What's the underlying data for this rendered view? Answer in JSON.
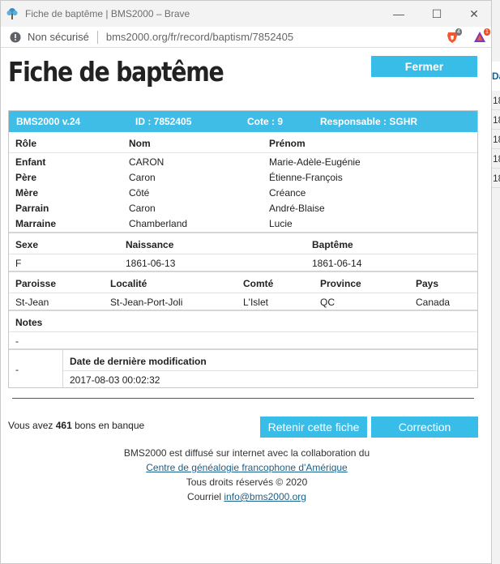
{
  "window": {
    "title": "Fiche de baptême | BMS2000 – Brave",
    "controls": {
      "minimize": "—",
      "maximize": "☐",
      "close": "✕"
    }
  },
  "address_bar": {
    "security_label": "Non sécurisé",
    "url": "bms2000.org/fr/record/baptism/7852405",
    "shield_count": "4",
    "rewards_count": "1"
  },
  "page": {
    "title": "Fiche de baptême",
    "close_label": "Fermer"
  },
  "record": {
    "banner": {
      "version": "BMS2000 v.24",
      "id": "ID : 7852405",
      "cote": "Cote : 9",
      "responsable": "Responsable : SGHR"
    },
    "people_headers": {
      "role": "Rôle",
      "nom": "Nom",
      "prenom": "Prénom"
    },
    "people": [
      {
        "role": "Enfant",
        "nom": "CARON",
        "prenom": "Marie-Adèle-Eugénie"
      },
      {
        "role": "Père",
        "nom": "Caron",
        "prenom": "Étienne-François"
      },
      {
        "role": "Mère",
        "nom": "Côté",
        "prenom": "Créance"
      },
      {
        "role": "Parrain",
        "nom": "Caron",
        "prenom": "André-Blaise"
      },
      {
        "role": "Marraine",
        "nom": "Chamberland",
        "prenom": "Lucie"
      }
    ],
    "vitals_headers": {
      "sexe": "Sexe",
      "naissance": "Naissance",
      "bapteme": "Baptême"
    },
    "vitals": {
      "sexe": "F",
      "naissance": "1861-06-13",
      "bapteme": "1861-06-14"
    },
    "place_headers": {
      "paroisse": "Paroisse",
      "localite": "Localité",
      "comte": "Comté",
      "province": "Province",
      "pays": "Pays"
    },
    "place": {
      "paroisse": "St-Jean",
      "localite": "St-Jean-Port-Joli",
      "comte": "L'Islet",
      "province": "QC",
      "pays": "Canada"
    },
    "notes_header": "Notes",
    "notes": "-",
    "modif_left": "-",
    "modif_header": "Date de dernière modification",
    "modif_value": "2017-08-03 00:02:32"
  },
  "footer": {
    "bank_prefix": "Vous avez",
    "bank_count": "461",
    "bank_suffix": "bons en banque",
    "retain_label": "Retenir cette fiche",
    "correction_label": "Correction",
    "credit_line": "BMS2000 est diffusé sur internet avec la collaboration du",
    "partner_link": "Centre de généalogie francophone d'Amérique",
    "rights": "Tous droits réservés © 2020",
    "email_prefix": "Courriel",
    "email_link": "info@bms2000.org"
  },
  "background_window": {
    "header_fragment": "Da",
    "rows": [
      "18",
      "18",
      "18",
      "18",
      "18"
    ]
  }
}
